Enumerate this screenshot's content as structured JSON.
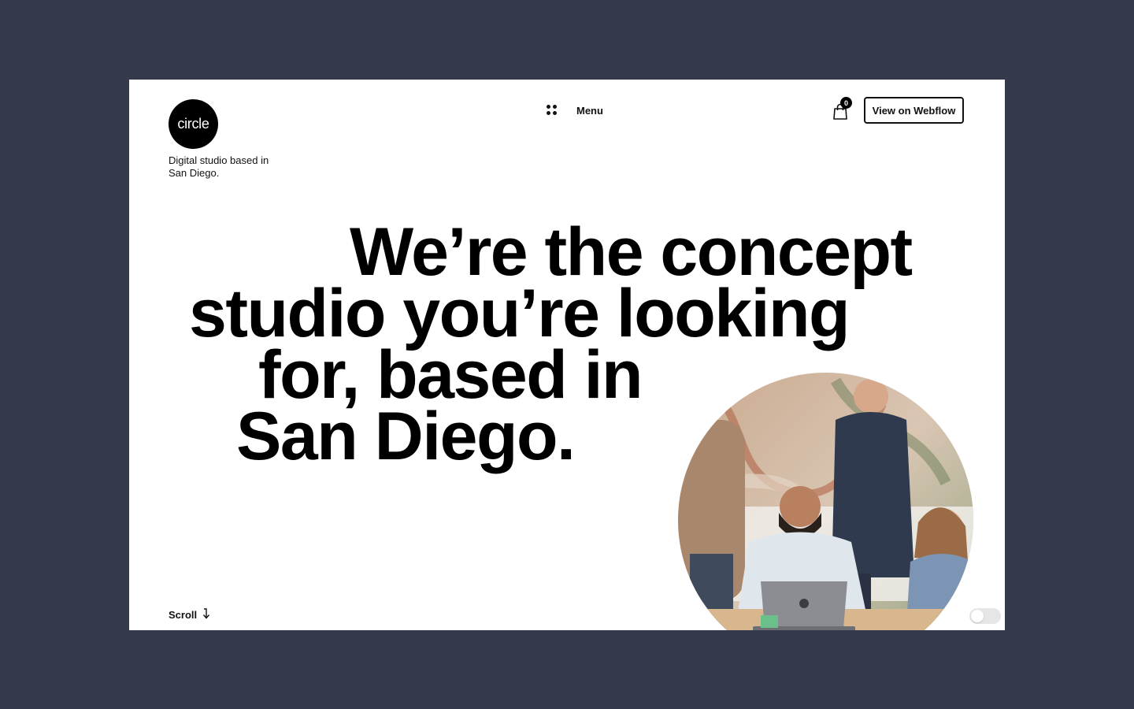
{
  "brand": {
    "logo_text": "circle",
    "tagline": "Digital studio based in San Diego."
  },
  "nav": {
    "menu_label": "Menu",
    "menu_icon": "grid-dots-icon",
    "cart_icon": "shopping-bag-icon",
    "cart_count": "0",
    "cta_label": "View on Webflow"
  },
  "hero": {
    "lines": [
      "We’re the concept",
      "studio you’re looking",
      "for, based in",
      "San Diego."
    ],
    "photo": "team-at-laptop-photo"
  },
  "footer": {
    "scroll_label": "Scroll",
    "scroll_icon": "arrow-down-icon",
    "toggle_state": "off"
  },
  "colors": {
    "background": "#343a4c",
    "page": "#ffffff",
    "text": "#000000"
  }
}
